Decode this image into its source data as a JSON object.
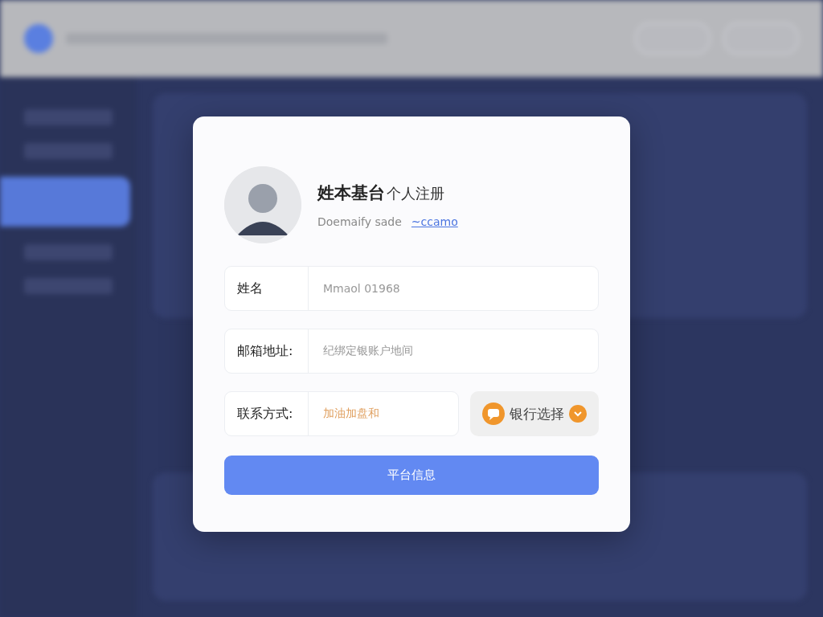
{
  "dialog": {
    "title": "姓本基台",
    "subtitle": "个人注册",
    "caption": "Doemaify sade",
    "link": "~ccamo",
    "fields": [
      {
        "label": "姓名",
        "value": "Mmaol 01968",
        "kind": "plain"
      },
      {
        "label": "邮箱地址:",
        "value": "纪绑定银账户地间",
        "kind": "plain"
      },
      {
        "label": "联系方式:",
        "value": "加油加盘和",
        "kind": "accent"
      }
    ],
    "bank_button": "银行选择",
    "submit": "平台信息"
  }
}
